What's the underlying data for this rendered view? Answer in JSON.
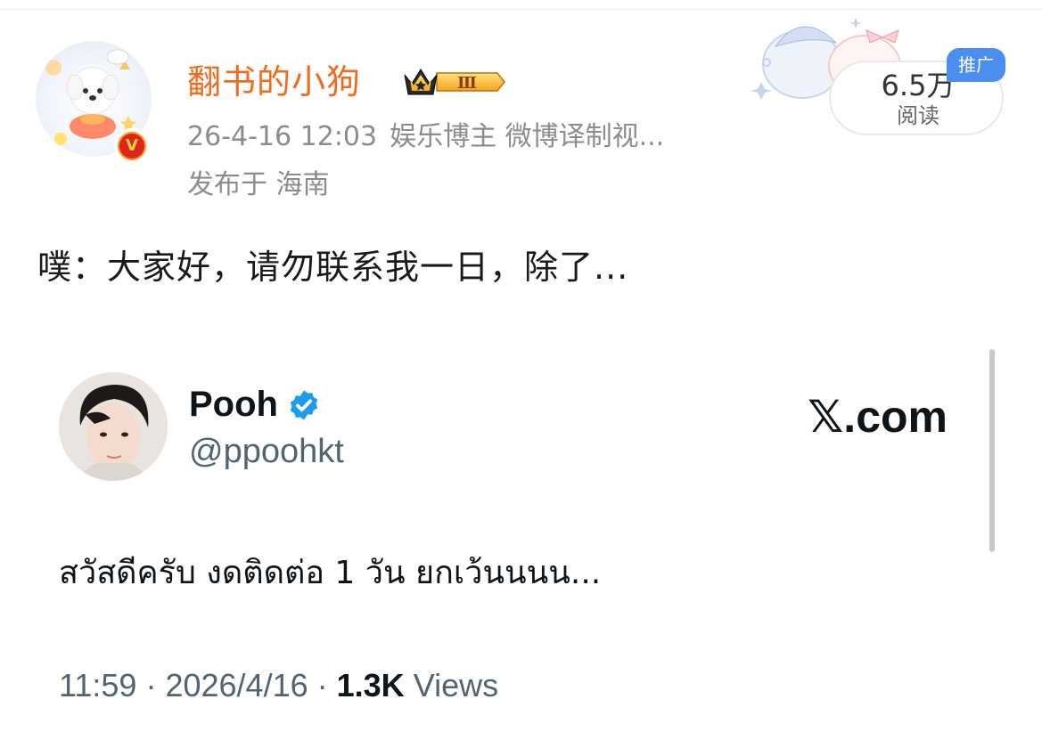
{
  "post": {
    "author": {
      "name": "翻书的小狗",
      "vip_level": "Ⅲ",
      "verified_mark": "V"
    },
    "timestamp": "26-4-16 12:03",
    "category": "娱乐博主 微博译制视...",
    "location": "发布于 海南",
    "read_count": "6.5万",
    "read_label": "阅读",
    "promo_tag": "推广",
    "text": "噗：大家好，请勿联系我一日，除了..."
  },
  "embed": {
    "display_name": "Pooh",
    "handle": "@ppoohkt",
    "brand": "com",
    "brand_glyph": "𝕏",
    "brand_dot": ".",
    "tweet_text": "สวัสดีครับ งดติดต่อ 1 วัน ยกเว้นนนน...",
    "time": "11:59",
    "sep": "·",
    "date": "2026/4/16",
    "views_count": "1.3K",
    "views_label": "Views"
  },
  "colors": {
    "username": "#f26b1d",
    "meta": "#8c8c8c",
    "promo": "#4a8ef0",
    "x_verified": "#1d9bf0",
    "x_secondary": "#536471"
  },
  "icons": [
    "avatar-dog-illustration",
    "v-verified-badge",
    "crown-vip-badge",
    "x-verified-badge"
  ]
}
